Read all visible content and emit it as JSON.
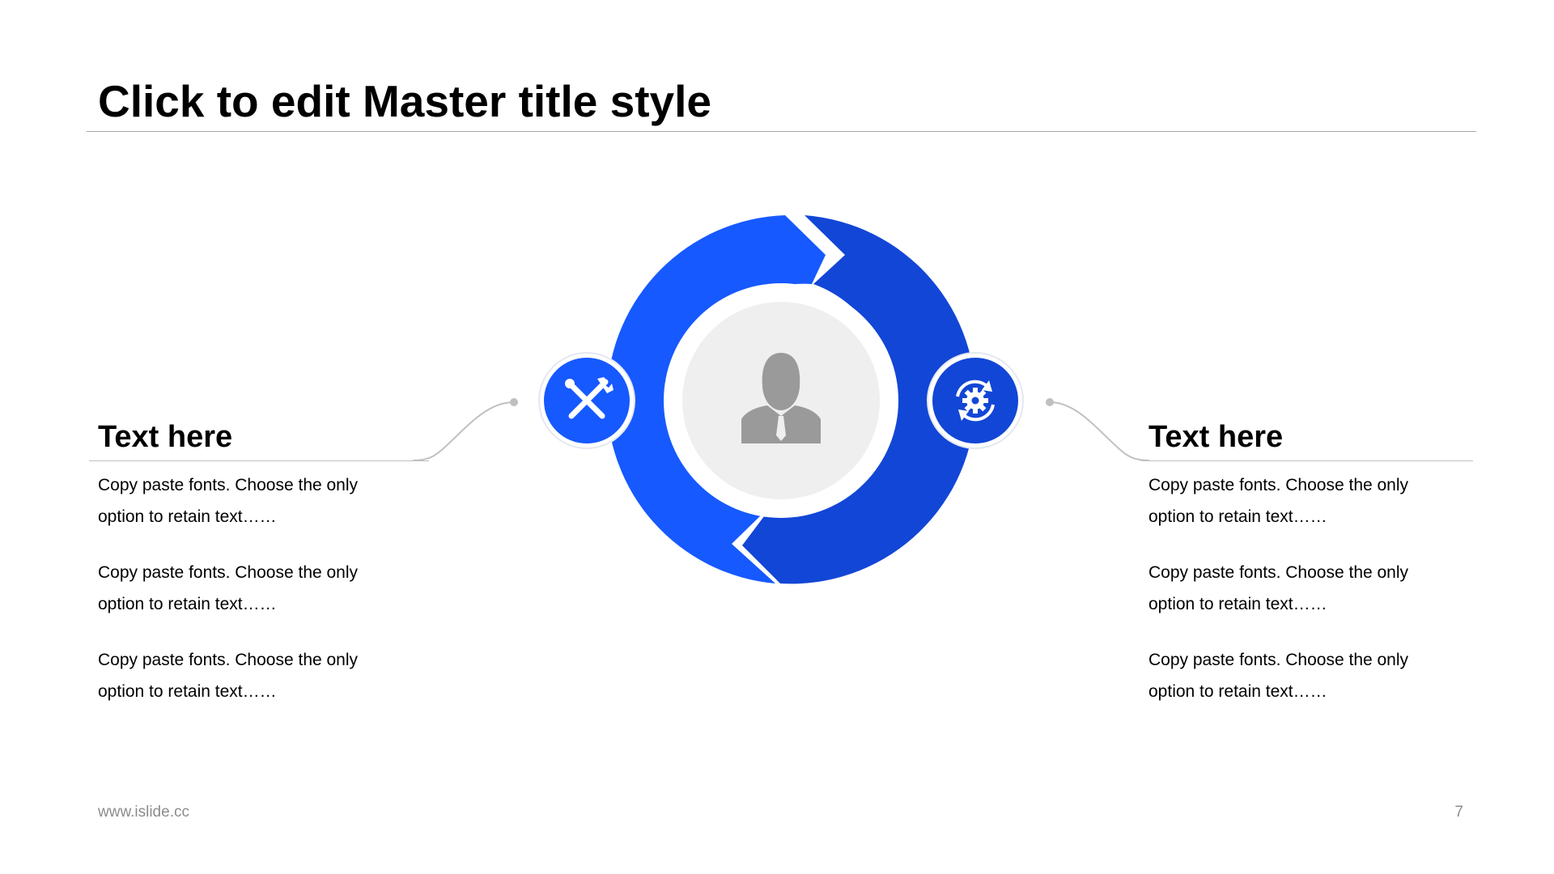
{
  "slide": {
    "title": "Click to edit Master title style",
    "footer_url": "www.islide.cc",
    "page_number": "7"
  },
  "colors": {
    "accent_light": "#1659ff",
    "accent_dark": "#1246d6",
    "inner_ring": "#ffffff",
    "center_fill": "#efefef",
    "person_icon": "#9a9a9a",
    "connector": "#c0c0c0"
  },
  "diagram": {
    "center_icon": "person-icon",
    "left_node_icon": "tools-icon",
    "right_node_icon": "gear-refresh-icon"
  },
  "left_panel": {
    "heading": "Text here",
    "paragraphs": [
      "Copy paste fonts. Choose the only option to retain text……",
      "Copy paste fonts. Choose the only option to retain text……",
      "Copy paste fonts. Choose the only option to retain text……"
    ]
  },
  "right_panel": {
    "heading": "Text here",
    "paragraphs": [
      "Copy paste fonts. Choose the only option to retain text……",
      "Copy paste fonts. Choose the only option to retain text……",
      "Copy paste fonts. Choose the only option to retain text……"
    ]
  }
}
